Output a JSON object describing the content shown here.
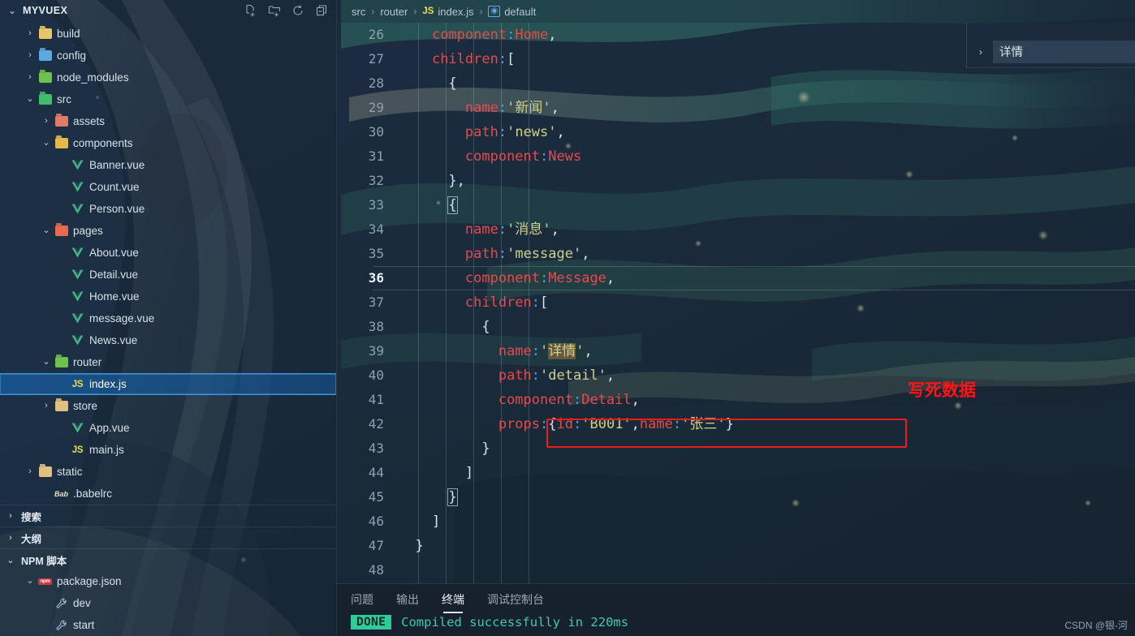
{
  "sidebar": {
    "title": "MYVUEX",
    "twisty_open": "⌄",
    "twisty_closed": "›",
    "actions": [
      {
        "name": "new-file-icon",
        "label": "新建文件"
      },
      {
        "name": "new-folder-icon",
        "label": "新建文件夹"
      },
      {
        "name": "refresh-icon",
        "label": "刷新资源管理器"
      },
      {
        "name": "collapse-all-icon",
        "label": "折叠文件夹"
      }
    ],
    "tree": [
      {
        "label": "build",
        "indent": 1,
        "twisty": "›",
        "icon": "folder",
        "color": "#e8c468"
      },
      {
        "label": "config",
        "indent": 1,
        "twisty": "›",
        "icon": "folder",
        "color": "#5aa9e0"
      },
      {
        "label": "node_modules",
        "indent": 1,
        "twisty": "›",
        "icon": "folder",
        "color": "#6cc24a"
      },
      {
        "label": "src",
        "indent": 1,
        "twisty": "⌄",
        "icon": "folder",
        "color": "#3fbf6e"
      },
      {
        "label": "assets",
        "indent": 2,
        "twisty": "›",
        "icon": "folder",
        "color": "#e07b6a"
      },
      {
        "label": "components",
        "indent": 2,
        "twisty": "⌄",
        "icon": "folder",
        "color": "#e8b84b"
      },
      {
        "label": "Banner.vue",
        "indent": 3,
        "twisty": "",
        "icon": "vue"
      },
      {
        "label": "Count.vue",
        "indent": 3,
        "twisty": "",
        "icon": "vue"
      },
      {
        "label": "Person.vue",
        "indent": 3,
        "twisty": "",
        "icon": "vue"
      },
      {
        "label": "pages",
        "indent": 2,
        "twisty": "⌄",
        "icon": "folder",
        "color": "#e8694f"
      },
      {
        "label": "About.vue",
        "indent": 3,
        "twisty": "",
        "icon": "vue"
      },
      {
        "label": "Detail.vue",
        "indent": 3,
        "twisty": "",
        "icon": "vue"
      },
      {
        "label": "Home.vue",
        "indent": 3,
        "twisty": "",
        "icon": "vue"
      },
      {
        "label": "message.vue",
        "indent": 3,
        "twisty": "",
        "icon": "vue"
      },
      {
        "label": "News.vue",
        "indent": 3,
        "twisty": "",
        "icon": "vue"
      },
      {
        "label": "router",
        "indent": 2,
        "twisty": "⌄",
        "icon": "folder",
        "color": "#6cc24a"
      },
      {
        "label": "index.js",
        "indent": 3,
        "twisty": "",
        "icon": "js",
        "selected": true
      },
      {
        "label": "store",
        "indent": 2,
        "twisty": "›",
        "icon": "folder",
        "color": "#e0c081"
      },
      {
        "label": "App.vue",
        "indent": 3,
        "twisty": "",
        "icon": "vue"
      },
      {
        "label": "main.js",
        "indent": 3,
        "twisty": "",
        "icon": "js"
      },
      {
        "label": "static",
        "indent": 1,
        "twisty": "›",
        "icon": "folder",
        "color": "#e0c081"
      },
      {
        "label": ".babelrc",
        "indent": 2,
        "twisty": "",
        "icon": "babel"
      }
    ],
    "sections": [
      {
        "label": "搜索",
        "twisty": "›"
      },
      {
        "label": "大纲",
        "twisty": "›"
      },
      {
        "label": "NPM 脚本",
        "twisty": "⌄"
      }
    ],
    "npm": [
      {
        "label": "package.json",
        "indent": 1,
        "twisty": "⌄",
        "icon": "npm"
      },
      {
        "label": "dev",
        "indent": 2,
        "twisty": "",
        "icon": "wrench"
      },
      {
        "label": "start",
        "indent": 2,
        "twisty": "",
        "icon": "wrench"
      }
    ]
  },
  "breadcrumb": {
    "items": [
      "src",
      "router",
      "index.js",
      "default"
    ],
    "separator": "›",
    "js_badge": "JS",
    "symbol_badge": "[@]"
  },
  "editor": {
    "first_line_number": 26,
    "current_line": 36,
    "lines": [
      {
        "n": 26,
        "tokens": [
          {
            "t": "    ",
            "c": "pl"
          },
          {
            "t": "component",
            "c": "k"
          },
          {
            "t": ":",
            "c": "pun"
          },
          {
            "t": "Home",
            "c": "k"
          },
          {
            "t": ",",
            "c": "cm"
          }
        ]
      },
      {
        "n": 27,
        "tokens": [
          {
            "t": "    ",
            "c": "pl"
          },
          {
            "t": "children",
            "c": "k"
          },
          {
            "t": ":",
            "c": "pun"
          },
          {
            "t": "[",
            "c": "br"
          }
        ]
      },
      {
        "n": 28,
        "tokens": [
          {
            "t": "      ",
            "c": "pl"
          },
          {
            "t": "{",
            "c": "br"
          }
        ]
      },
      {
        "n": 29,
        "tokens": [
          {
            "t": "        ",
            "c": "pl"
          },
          {
            "t": "name",
            "c": "k"
          },
          {
            "t": ":",
            "c": "pun"
          },
          {
            "t": "'新闻'",
            "c": "str"
          },
          {
            "t": ",",
            "c": "cm"
          }
        ]
      },
      {
        "n": 30,
        "tokens": [
          {
            "t": "        ",
            "c": "pl"
          },
          {
            "t": "path",
            "c": "k"
          },
          {
            "t": ":",
            "c": "pun"
          },
          {
            "t": "'news'",
            "c": "str"
          },
          {
            "t": ",",
            "c": "cm"
          }
        ]
      },
      {
        "n": 31,
        "tokens": [
          {
            "t": "        ",
            "c": "pl"
          },
          {
            "t": "component",
            "c": "k"
          },
          {
            "t": ":",
            "c": "pun"
          },
          {
            "t": "News",
            "c": "k"
          }
        ]
      },
      {
        "n": 32,
        "tokens": [
          {
            "t": "      ",
            "c": "pl"
          },
          {
            "t": "}",
            "c": "br"
          },
          {
            "t": ",",
            "c": "cm"
          }
        ]
      },
      {
        "n": 33,
        "tokens": [
          {
            "t": "      ",
            "c": "pl"
          },
          {
            "t": "{",
            "c": "br bmatch"
          }
        ]
      },
      {
        "n": 34,
        "tokens": [
          {
            "t": "        ",
            "c": "pl"
          },
          {
            "t": "name",
            "c": "k"
          },
          {
            "t": ":",
            "c": "pun"
          },
          {
            "t": "'消息'",
            "c": "str"
          },
          {
            "t": ",",
            "c": "cm"
          }
        ]
      },
      {
        "n": 35,
        "tokens": [
          {
            "t": "        ",
            "c": "pl"
          },
          {
            "t": "path",
            "c": "k"
          },
          {
            "t": ":",
            "c": "pun"
          },
          {
            "t": "'message'",
            "c": "str"
          },
          {
            "t": ",",
            "c": "cm"
          }
        ]
      },
      {
        "n": 36,
        "tokens": [
          {
            "t": "        ",
            "c": "pl"
          },
          {
            "t": "component",
            "c": "k"
          },
          {
            "t": ":",
            "c": "pun"
          },
          {
            "t": "Message",
            "c": "k"
          },
          {
            "t": ",",
            "c": "cm"
          }
        ]
      },
      {
        "n": 37,
        "tokens": [
          {
            "t": "        ",
            "c": "pl"
          },
          {
            "t": "children",
            "c": "k"
          },
          {
            "t": ":",
            "c": "pun"
          },
          {
            "t": "[",
            "c": "br"
          }
        ]
      },
      {
        "n": 38,
        "tokens": [
          {
            "t": "          ",
            "c": "pl"
          },
          {
            "t": "{",
            "c": "br"
          }
        ]
      },
      {
        "n": 39,
        "tokens": [
          {
            "t": "            ",
            "c": "pl"
          },
          {
            "t": "name",
            "c": "k"
          },
          {
            "t": ":",
            "c": "pun"
          },
          {
            "t": "'",
            "c": "str"
          },
          {
            "t": "详情",
            "c": "str sel"
          },
          {
            "t": "'",
            "c": "str"
          },
          {
            "t": ",",
            "c": "cm"
          }
        ]
      },
      {
        "n": 40,
        "tokens": [
          {
            "t": "            ",
            "c": "pl"
          },
          {
            "t": "path",
            "c": "k"
          },
          {
            "t": ":",
            "c": "pun"
          },
          {
            "t": "'detail'",
            "c": "str"
          },
          {
            "t": ",",
            "c": "cm"
          }
        ]
      },
      {
        "n": 41,
        "tokens": [
          {
            "t": "            ",
            "c": "pl"
          },
          {
            "t": "component",
            "c": "k"
          },
          {
            "t": ":",
            "c": "pun"
          },
          {
            "t": "Detail",
            "c": "k"
          },
          {
            "t": ",",
            "c": "cm"
          }
        ]
      },
      {
        "n": 42,
        "tokens": [
          {
            "t": "            ",
            "c": "pl"
          },
          {
            "t": "props",
            "c": "k"
          },
          {
            "t": ":",
            "c": "pun"
          },
          {
            "t": "{",
            "c": "br"
          },
          {
            "t": "id",
            "c": "k"
          },
          {
            "t": ":",
            "c": "pun"
          },
          {
            "t": "'B001'",
            "c": "str"
          },
          {
            "t": ",",
            "c": "cm"
          },
          {
            "t": "name",
            "c": "k"
          },
          {
            "t": ":",
            "c": "pun"
          },
          {
            "t": "'张三'",
            "c": "str"
          },
          {
            "t": "}",
            "c": "br"
          }
        ]
      },
      {
        "n": 43,
        "tokens": [
          {
            "t": "          ",
            "c": "pl"
          },
          {
            "t": "}",
            "c": "br"
          }
        ]
      },
      {
        "n": 44,
        "tokens": [
          {
            "t": "        ",
            "c": "pl"
          },
          {
            "t": "]",
            "c": "br"
          }
        ]
      },
      {
        "n": 45,
        "tokens": [
          {
            "t": "      ",
            "c": "pl"
          },
          {
            "t": "}",
            "c": "br bmatch"
          }
        ]
      },
      {
        "n": 46,
        "tokens": [
          {
            "t": "    ",
            "c": "pl"
          },
          {
            "t": "]",
            "c": "br"
          }
        ]
      },
      {
        "n": 47,
        "tokens": [
          {
            "t": "  ",
            "c": "pl"
          },
          {
            "t": "}",
            "c": "br"
          }
        ]
      },
      {
        "n": 48,
        "tokens": [
          {
            "t": "",
            "c": "pl"
          }
        ]
      }
    ],
    "annotation": "写死数据",
    "annotation_color": "#ff1414",
    "highlight_box_color": "#f01a1a"
  },
  "right_panel": {
    "twisty": "›",
    "item_label": "详情"
  },
  "panel": {
    "tabs": [
      {
        "label": "问题",
        "active": false
      },
      {
        "label": "输出",
        "active": false
      },
      {
        "label": "终端",
        "active": true
      },
      {
        "label": "调试控制台",
        "active": false
      }
    ],
    "terminal": {
      "badge": "DONE",
      "badge_color": "#2ecc9b",
      "message": "Compiled successfully in 220ms",
      "message_color": "#3fc9a7"
    }
  },
  "watermark": "CSDN @银-河"
}
